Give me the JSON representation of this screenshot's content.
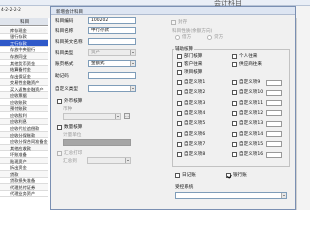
{
  "background": {
    "title": "会计科目",
    "coding_rule": "4-2-2-2-2",
    "header_label": "科目",
    "accounts": [
      {
        "name": "库存现金",
        "selected": false
      },
      {
        "name": "银行存款",
        "selected": false
      },
      {
        "name": "工行存款",
        "selected": true
      },
      {
        "name": "存放中央银行",
        "selected": false
      },
      {
        "name": "存放同业",
        "selected": false
      },
      {
        "name": "其他货币资金",
        "selected": false
      },
      {
        "name": "结算备付金",
        "selected": false
      },
      {
        "name": "存出保证金",
        "selected": false
      },
      {
        "name": "交易性金融资产",
        "selected": false
      },
      {
        "name": "买入返售金融资产",
        "selected": false
      },
      {
        "name": "应收票据",
        "selected": false
      },
      {
        "name": "应收账款",
        "selected": false
      },
      {
        "name": "预付账款",
        "selected": false
      },
      {
        "name": "应收股利",
        "selected": false
      },
      {
        "name": "应收利息",
        "selected": false
      },
      {
        "name": "应收代位追偿款",
        "selected": false
      },
      {
        "name": "应收分保账款",
        "selected": false
      },
      {
        "name": "应收分保合同准备金",
        "selected": false
      },
      {
        "name": "其他应收款",
        "selected": false
      },
      {
        "name": "坏账准备",
        "selected": false
      },
      {
        "name": "贴现资产",
        "selected": false
      },
      {
        "name": "拆出资金",
        "selected": false
      },
      {
        "name": "贷款",
        "selected": false
      },
      {
        "name": "贷款损失准备",
        "selected": false
      },
      {
        "name": "代理兑付证券",
        "selected": false
      },
      {
        "name": "代理业务资产",
        "selected": false
      }
    ]
  },
  "dialog": {
    "title": "新增会计科目",
    "code_label": "科目编码",
    "code_value": "100202",
    "name_label": "科目名称",
    "name_value": "中行存款",
    "english_label": "科目英文名称",
    "english_value": "",
    "type_label": "科目类型",
    "type_value": "资产",
    "format_label": "账页格式",
    "format_value": "金额式",
    "mnemonic_label": "助记码",
    "mnemonic_value": "",
    "custom_type_label": "自定义类型",
    "custom_type_value": "",
    "foreign_label": "外币核算",
    "currency_label": "币种",
    "currency_value": "",
    "quantity_label": "数量核算",
    "unit_label": "计量单位",
    "unit_value": "",
    "summary_print_label": "汇总打印",
    "summary_to_label": "汇总到",
    "summary_to_value": "",
    "seal_label": "封存",
    "direction_label": "科目性质(余额方向)",
    "debit_label": "借方",
    "credit_label": "贷方",
    "aux_title": "辅助核算",
    "aux_items": [
      {
        "label": "部门核算",
        "checked": false
      },
      {
        "label": "个人往来",
        "checked": false
      },
      {
        "label": "客户往来",
        "checked": false
      },
      {
        "label": "供应商往来",
        "checked": false
      },
      {
        "label": "项目核算",
        "checked": false
      },
      {
        "label": "自定义项1",
        "checked": false
      },
      {
        "label": "自定义项9",
        "checked": false
      },
      {
        "label": "自定义项2",
        "checked": false
      },
      {
        "label": "自定义项10",
        "checked": false
      },
      {
        "label": "自定义项3",
        "checked": false
      },
      {
        "label": "自定义项11",
        "checked": false
      },
      {
        "label": "自定义项4",
        "checked": false
      },
      {
        "label": "自定义项12",
        "checked": false
      },
      {
        "label": "自定义项5",
        "checked": false
      },
      {
        "label": "自定义项13",
        "checked": false
      },
      {
        "label": "自定义项6",
        "checked": false
      },
      {
        "label": "自定义项14",
        "checked": false
      },
      {
        "label": "自定义项7",
        "checked": false
      },
      {
        "label": "自定义项15",
        "checked": false
      },
      {
        "label": "自定义项8",
        "checked": false
      },
      {
        "label": "自定义项16",
        "checked": false
      }
    ],
    "journal_label": "日记账",
    "journal_checked": false,
    "bank_label": "银行账",
    "bank_checked": true,
    "control_label": "受控系统",
    "control_value": ""
  }
}
